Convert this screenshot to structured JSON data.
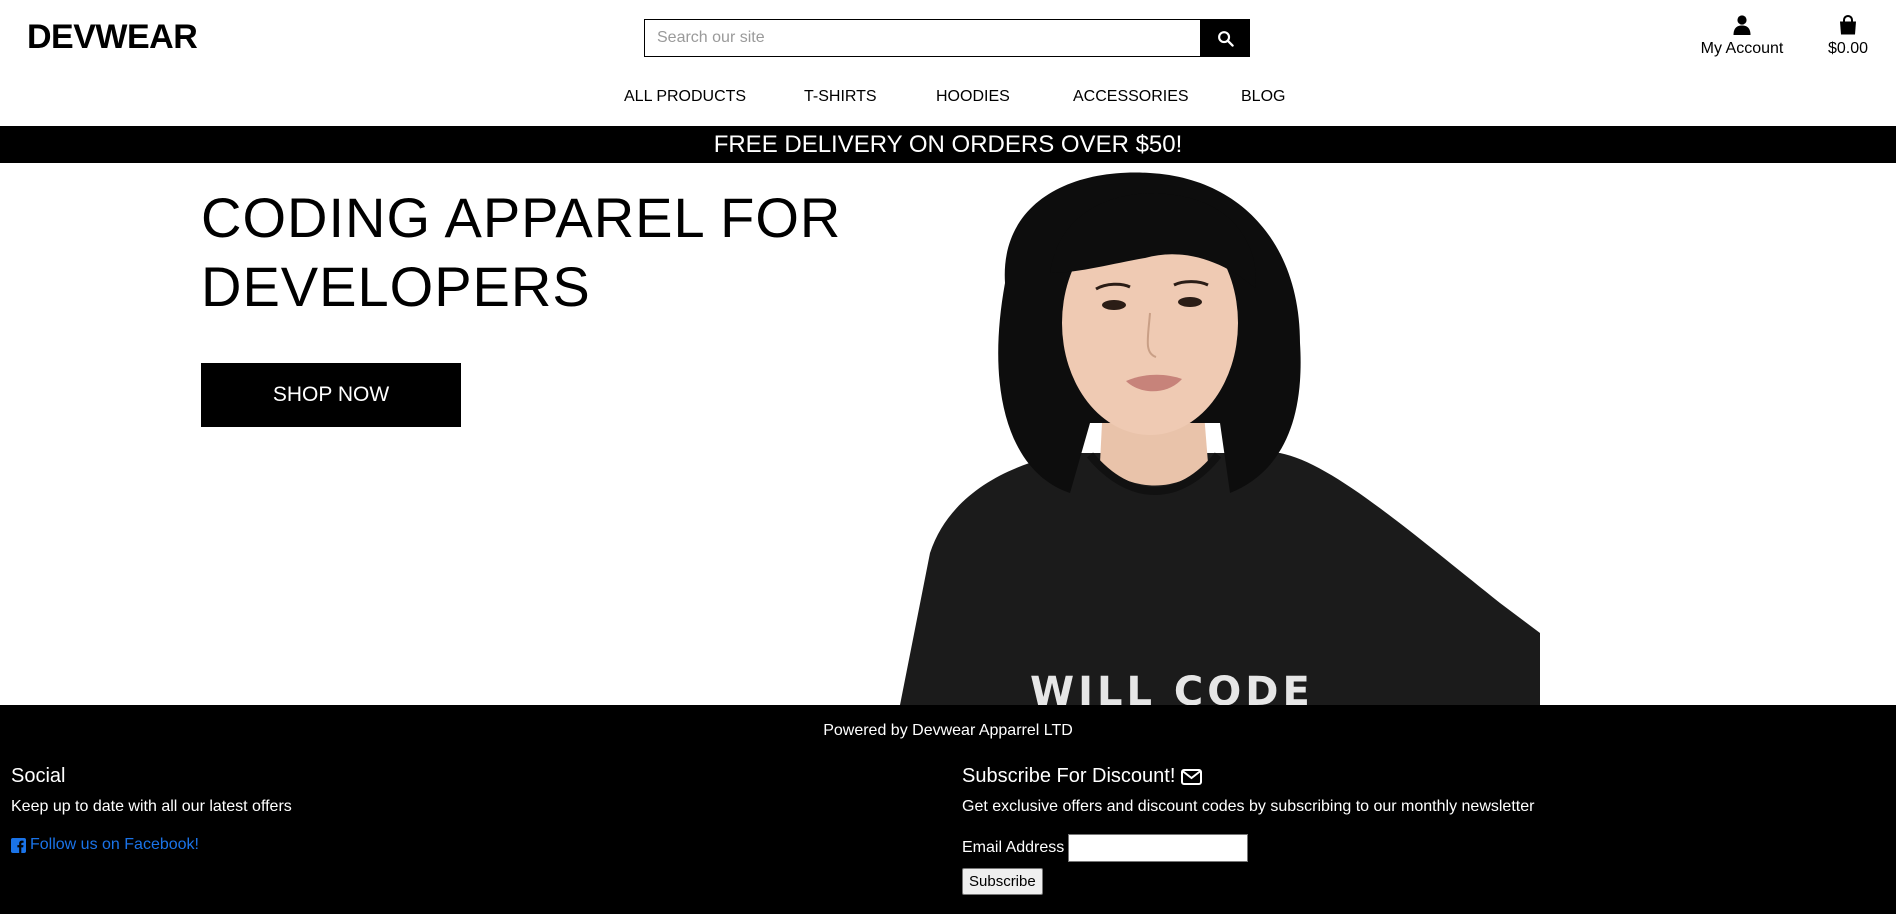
{
  "header": {
    "logo": "DEVWEAR",
    "search_placeholder": "Search our site",
    "search_button_icon": "search-icon",
    "account_label": "My Account",
    "account_icon": "user-icon",
    "cart_total": "$0.00",
    "cart_icon": "shopping-bag-icon"
  },
  "nav": {
    "items": [
      {
        "label": "ALL PRODUCTS"
      },
      {
        "label": "T-SHIRTS"
      },
      {
        "label": "HOODIES"
      },
      {
        "label": "ACCESSORIES"
      },
      {
        "label": "BLOG"
      }
    ]
  },
  "banner": {
    "text": "FREE DELIVERY ON ORDERS OVER $50!"
  },
  "hero": {
    "headline": "CODING APPAREL FOR DEVELOPERS",
    "cta_label": "SHOP NOW",
    "image_shirt_text": "WILL CODE"
  },
  "footer": {
    "powered_by": "Powered by Devwear Apparrel LTD",
    "social": {
      "title": "Social",
      "text": "Keep up to date with all our latest offers",
      "facebook_label": "Follow us on Facebook!",
      "facebook_icon": "facebook-square-icon"
    },
    "subscribe": {
      "title": "Subscribe For Discount!",
      "title_icon": "envelope-icon",
      "text": "Get exclusive offers and discount codes by subscribing to our monthly newsletter",
      "email_label": "Email Address",
      "email_value": "",
      "button_label": "Subscribe"
    }
  },
  "colors": {
    "primary": "#000000",
    "background": "#ffffff",
    "link": "#1a73e8"
  }
}
